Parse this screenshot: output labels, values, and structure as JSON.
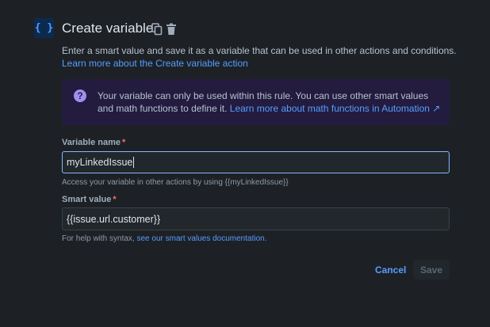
{
  "header": {
    "icon": "curly-braces-icon",
    "icon_text": "{ }",
    "title": "Create variable"
  },
  "description": {
    "text": "Enter a smart value and save it as a variable that can be used in other actions and conditions.",
    "link": "Learn more about the Create variable action"
  },
  "info": {
    "text": "Your variable can only be used within this rule. You can use other smart values and math functions to define it.",
    "link": "Learn more about math functions in Automation ↗"
  },
  "variable_name": {
    "label": "Variable name",
    "required": "*",
    "value": "myLinkedIssue",
    "helper": "Access your variable in other actions by using {{myLinkedIssue}}"
  },
  "smart_value": {
    "label": "Smart value",
    "required": "*",
    "value": "{{issue.url.customer}}",
    "helper": "For help with syntax,",
    "helper_link": "see our smart values documentation."
  },
  "buttons": {
    "cancel": "Cancel",
    "save": "Save"
  }
}
